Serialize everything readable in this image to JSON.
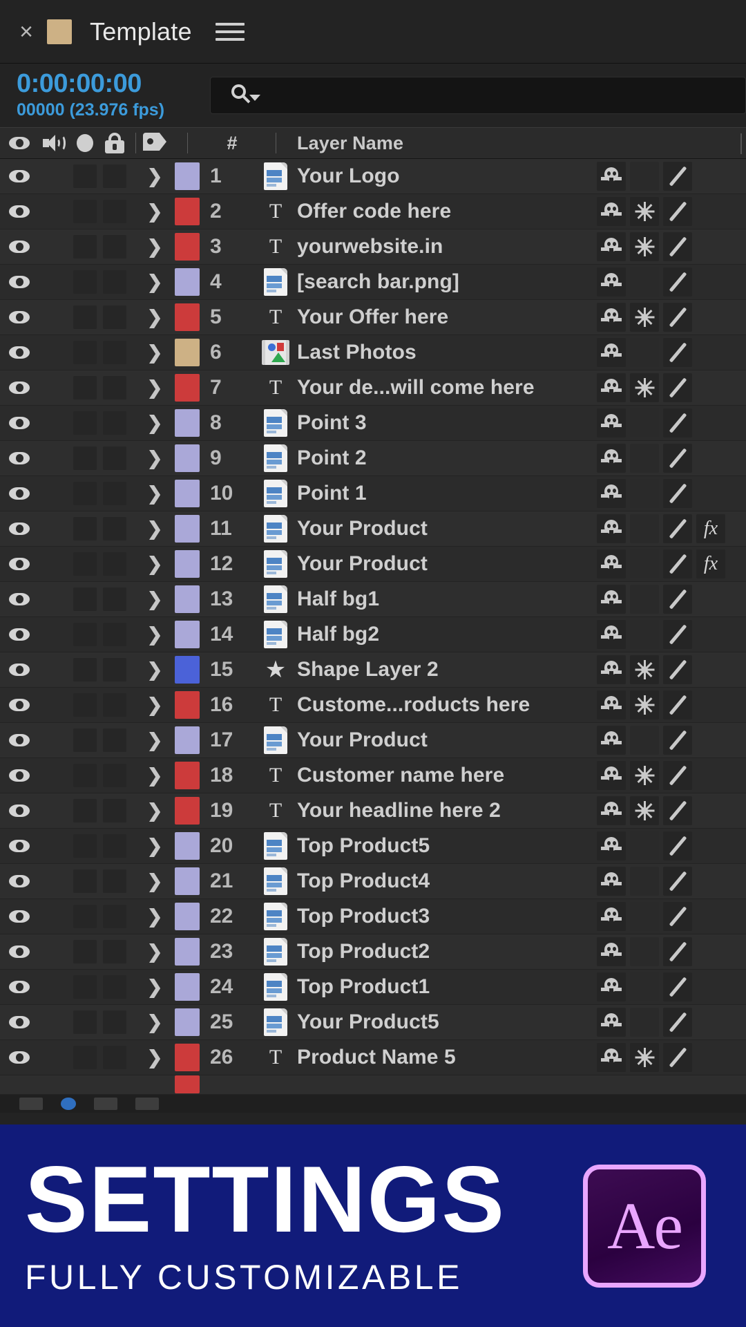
{
  "panel": {
    "close_label": "×",
    "title": "Template",
    "menu_icon": "hamburger-menu-icon",
    "swatch_color": "#cdb185"
  },
  "time": {
    "timecode": "0:00:00:00",
    "framecount": "00000 (23.976 fps)",
    "accent_color": "#3c9bdb"
  },
  "search": {
    "value": "",
    "placeholder": "",
    "icon": "search-icon"
  },
  "columns": {
    "video_icon": "eye-icon",
    "audio_icon": "speaker-icon",
    "solo_icon": "solo-dot-icon",
    "lock_icon": "lock-icon",
    "label_icon": "tag-icon",
    "number": "#",
    "layer_name": "Layer Name"
  },
  "switch_icons": {
    "rasterize": "continuously-rasterize-icon",
    "quality": "sun-quality-icon",
    "motion_blur": "motion-blur-icon",
    "effects": "fx"
  },
  "layers": [
    {
      "num": "1",
      "color": "#aaa8d8",
      "type": "image",
      "name": "Your Logo",
      "rasterize": true,
      "quality": false,
      "blur": true,
      "fx": false
    },
    {
      "num": "2",
      "color": "#cc3b3b",
      "type": "text",
      "name": "Offer code here",
      "rasterize": true,
      "quality": true,
      "blur": true,
      "fx": false
    },
    {
      "num": "3",
      "color": "#cc3b3b",
      "type": "text",
      "name": "yourwebsite.in",
      "rasterize": true,
      "quality": true,
      "blur": true,
      "fx": false
    },
    {
      "num": "4",
      "color": "#aaa8d8",
      "type": "image",
      "name": "[search bar.png]",
      "rasterize": true,
      "quality": false,
      "blur": true,
      "fx": false
    },
    {
      "num": "5",
      "color": "#cc3b3b",
      "type": "text",
      "name": "Your Offer here",
      "rasterize": true,
      "quality": true,
      "blur": true,
      "fx": false
    },
    {
      "num": "6",
      "color": "#cdb185",
      "type": "comp",
      "name": "Last Photos",
      "rasterize": true,
      "quality": false,
      "blur": true,
      "fx": false
    },
    {
      "num": "7",
      "color": "#cc3b3b",
      "type": "text",
      "name": "Your de...will come here",
      "rasterize": true,
      "quality": true,
      "blur": true,
      "fx": false
    },
    {
      "num": "8",
      "color": "#aaa8d8",
      "type": "image",
      "name": "Point 3",
      "rasterize": true,
      "quality": false,
      "blur": true,
      "fx": false
    },
    {
      "num": "9",
      "color": "#aaa8d8",
      "type": "image",
      "name": "Point 2",
      "rasterize": true,
      "quality": false,
      "blur": true,
      "fx": false
    },
    {
      "num": "10",
      "color": "#aaa8d8",
      "type": "image",
      "name": "Point 1",
      "rasterize": true,
      "quality": false,
      "blur": true,
      "fx": false
    },
    {
      "num": "11",
      "color": "#aaa8d8",
      "type": "image",
      "name": "Your Product",
      "rasterize": true,
      "quality": false,
      "blur": true,
      "fx": true
    },
    {
      "num": "12",
      "color": "#aaa8d8",
      "type": "image",
      "name": "Your Product",
      "rasterize": true,
      "quality": false,
      "blur": true,
      "fx": true
    },
    {
      "num": "13",
      "color": "#aaa8d8",
      "type": "image",
      "name": "Half bg1",
      "rasterize": true,
      "quality": false,
      "blur": true,
      "fx": false
    },
    {
      "num": "14",
      "color": "#aaa8d8",
      "type": "image",
      "name": "Half bg2",
      "rasterize": true,
      "quality": false,
      "blur": true,
      "fx": false
    },
    {
      "num": "15",
      "color": "#4b62d8",
      "type": "shape",
      "name": "Shape Layer 2",
      "rasterize": true,
      "quality": true,
      "blur": true,
      "fx": false
    },
    {
      "num": "16",
      "color": "#cc3b3b",
      "type": "text",
      "name": "Custome...roducts here",
      "rasterize": true,
      "quality": true,
      "blur": true,
      "fx": false
    },
    {
      "num": "17",
      "color": "#aaa8d8",
      "type": "image",
      "name": "Your Product",
      "rasterize": true,
      "quality": false,
      "blur": true,
      "fx": false
    },
    {
      "num": "18",
      "color": "#cc3b3b",
      "type": "text",
      "name": "Customer name here",
      "rasterize": true,
      "quality": true,
      "blur": true,
      "fx": false
    },
    {
      "num": "19",
      "color": "#cc3b3b",
      "type": "text",
      "name": "Your headline here 2",
      "rasterize": true,
      "quality": true,
      "blur": true,
      "fx": false
    },
    {
      "num": "20",
      "color": "#aaa8d8",
      "type": "image",
      "name": "Top Product5",
      "rasterize": true,
      "quality": false,
      "blur": true,
      "fx": false
    },
    {
      "num": "21",
      "color": "#aaa8d8",
      "type": "image",
      "name": "Top Product4",
      "rasterize": true,
      "quality": false,
      "blur": true,
      "fx": false
    },
    {
      "num": "22",
      "color": "#aaa8d8",
      "type": "image",
      "name": "Top Product3",
      "rasterize": true,
      "quality": false,
      "blur": true,
      "fx": false
    },
    {
      "num": "23",
      "color": "#aaa8d8",
      "type": "image",
      "name": "Top Product2",
      "rasterize": true,
      "quality": false,
      "blur": true,
      "fx": false
    },
    {
      "num": "24",
      "color": "#aaa8d8",
      "type": "image",
      "name": "Top Product1",
      "rasterize": true,
      "quality": false,
      "blur": true,
      "fx": false
    },
    {
      "num": "25",
      "color": "#aaa8d8",
      "type": "image",
      "name": "Your Product5",
      "rasterize": true,
      "quality": false,
      "blur": true,
      "fx": false
    },
    {
      "num": "26",
      "color": "#cc3b3b",
      "type": "text",
      "name": "Product Name 5",
      "rasterize": true,
      "quality": true,
      "blur": true,
      "fx": false
    }
  ],
  "banner": {
    "title": "SETTINGS",
    "subtitle": "FULLY CUSTOMIZABLE",
    "logo_text": "Ae",
    "background_color": "#111b7a",
    "logo_accent": "#e9a6ff"
  }
}
